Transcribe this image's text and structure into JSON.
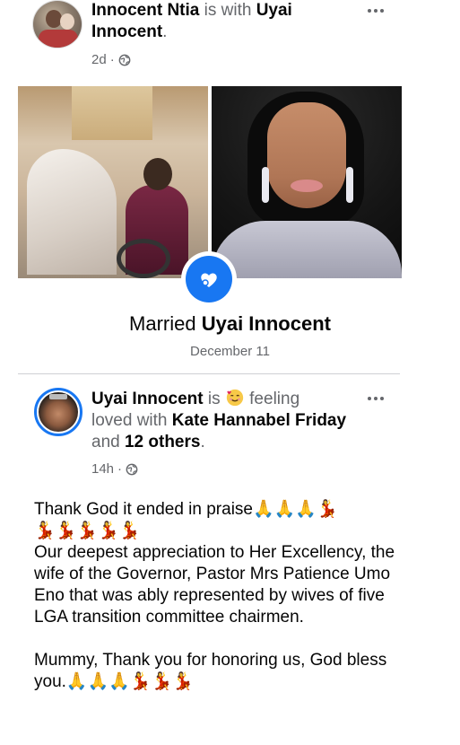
{
  "post1": {
    "author": "Innocent Ntia",
    "with_text": "is with",
    "tagged": "Uyai",
    "tagged2": "Innocent",
    "period": ".",
    "time": "2d",
    "dot": "·",
    "event": {
      "prefix": "Married",
      "name": "Uyai Innocent",
      "date": "December 11"
    },
    "icons": {
      "privacy": "globe-icon",
      "badge": "heart-icon",
      "more": "more-options-icon"
    }
  },
  "post2": {
    "author": "Uyai Innocent",
    "is": "is",
    "feeling_emoji": "smiling-face-with-hearts",
    "feeling": "feeling",
    "feeling_word": "loved",
    "with": "with",
    "tagged": "Kate Hannabel Friday",
    "and": "and",
    "others": "12 others",
    "period": ".",
    "time": "14h",
    "dot": "·",
    "body": {
      "line1": "Thank God it ended in praise",
      "line1_emojis": "🙏🙏🙏💃",
      "line2_emojis": "💃💃💃💃💃",
      "paragraph1": "Our deepest appreciation to Her Excellency, the wife of the Governor, Pastor Mrs Patience Umo Eno that was ably represented by wives of five LGA transition committee chairmen.",
      "paragraph2": "Mummy, Thank you for honoring us, God bless you.",
      "paragraph2_emojis": "🙏🙏🙏💃💃💃"
    }
  },
  "colors": {
    "accent": "#1877f2",
    "text": "#050505",
    "muted": "#65676b",
    "divider": "#ced0d4"
  }
}
